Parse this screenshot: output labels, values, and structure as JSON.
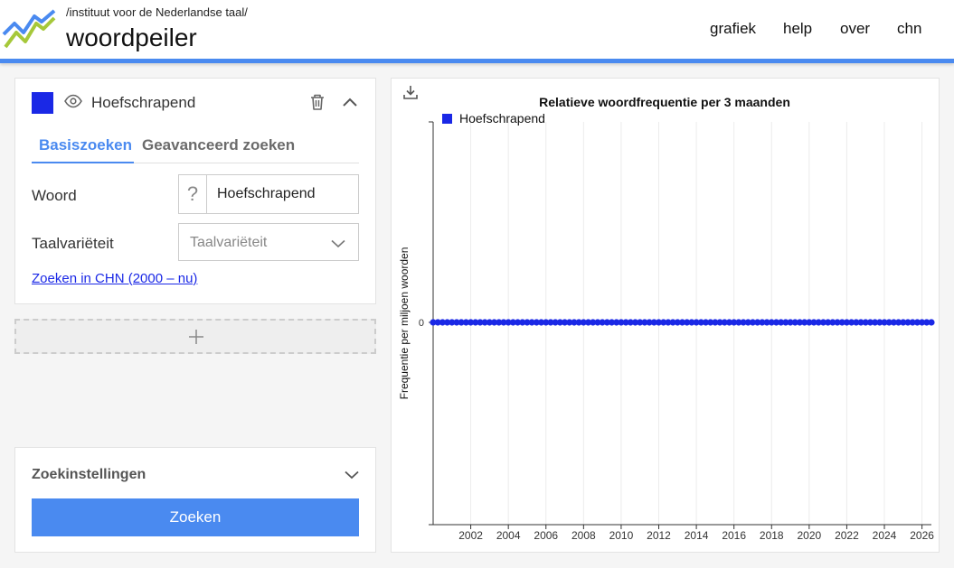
{
  "header": {
    "org": "/instituut voor de Nederlandse taal/",
    "brand": "woordpeiler",
    "nav": [
      "grafiek",
      "help",
      "over",
      "chn"
    ]
  },
  "term": {
    "name": "Hoefschrapend",
    "color": "#1a28e6"
  },
  "tabs": [
    "Basiszoeken",
    "Geavanceerd zoeken"
  ],
  "form": {
    "woord_label": "Woord",
    "woord_value": "Hoefschrapend",
    "hint_symbol": "?",
    "variety_label": "Taalvariëteit",
    "variety_placeholder": "Taalvariëteit",
    "chn_link": "Zoeken in CHN (2000 – nu)"
  },
  "settings": {
    "title": "Zoekinstellingen",
    "search_button": "Zoeken"
  },
  "colors": {
    "accent": "#4a8af0",
    "series": "#1a28e6"
  },
  "chart_data": {
    "type": "line",
    "title": "Relatieve woordfrequentie per 3 maanden",
    "ylabel": "Frequentie per miljoen woorden",
    "xlabel": "",
    "legend": "top-left",
    "grid": true,
    "x_ticks": [
      "2002",
      "2004",
      "2006",
      "2008",
      "2010",
      "2012",
      "2014",
      "2016",
      "2018",
      "2020",
      "2022",
      "2024",
      "2026"
    ],
    "y_ticks": [
      "0"
    ],
    "x_range": [
      2000,
      2026.5
    ],
    "series": [
      {
        "name": "Hoefschrapend",
        "x_start": 2000,
        "x_end": 2026.5,
        "step": 0.25,
        "constant_value": 0
      }
    ]
  }
}
